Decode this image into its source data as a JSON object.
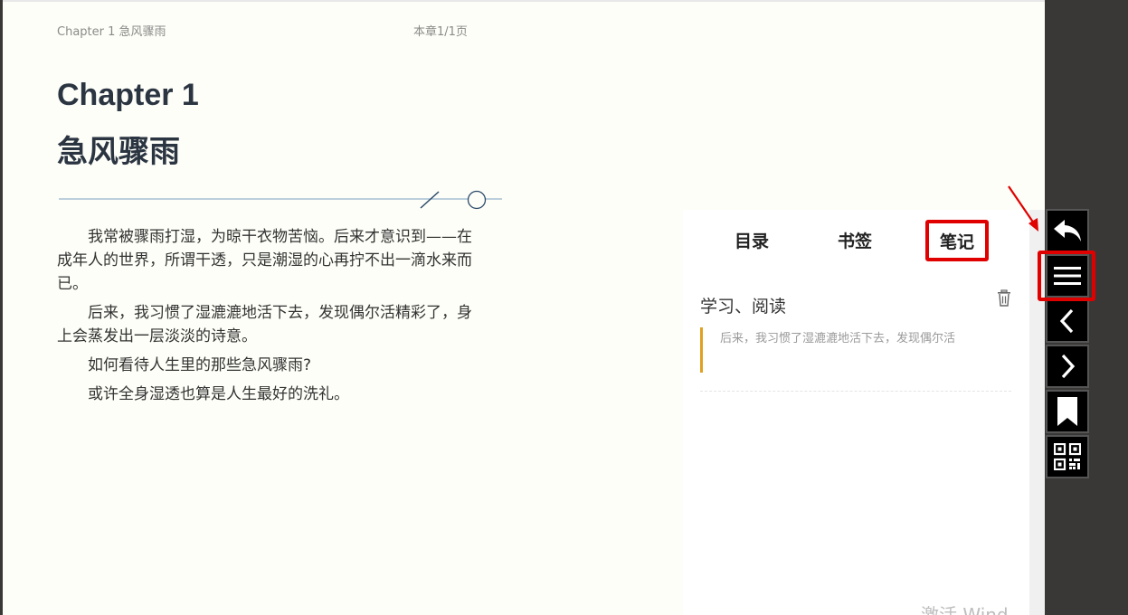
{
  "header": {
    "breadcrumb": "Chapter 1 急风骤雨",
    "page_indicator": "本章1/1页"
  },
  "chapter": {
    "title": "Chapter 1",
    "subtitle": "急风骤雨",
    "paragraphs": [
      "我常被骤雨打湿，为晾干衣物苦恼。后来才意识到——在成年人的世界，所谓干透，只是潮湿的心再拧不出一滴水来而已。",
      "后来，我习惯了湿漉漉地活下去，发现偶尔活精彩了，身上会蒸发出一层淡淡的诗意。",
      "如何看待人生里的那些急风骤雨?",
      "或许全身湿透也算是人生最好的洗礼。"
    ]
  },
  "panel": {
    "tabs": [
      {
        "label": "目录",
        "active": false
      },
      {
        "label": "书签",
        "active": false
      },
      {
        "label": "笔记",
        "active": true
      }
    ],
    "note": {
      "heading": "学习、阅读",
      "quote": "后来，我习惯了湿漉漉地活下去，发现偶尔活"
    },
    "watermark": "激活 Wind"
  },
  "toolbar": {
    "buttons": [
      {
        "icon": "back-arrow-icon"
      },
      {
        "icon": "menu-icon",
        "highlighted": true
      },
      {
        "icon": "chevron-left-icon"
      },
      {
        "icon": "chevron-right-icon"
      },
      {
        "icon": "bookmark-icon"
      },
      {
        "icon": "qr-code-icon"
      }
    ]
  },
  "colors": {
    "page_bg": "#fefef8",
    "frame_bg": "#3a3836",
    "highlight": "#e00000",
    "quote_bar": "#e0a020",
    "title": "#2b3542"
  }
}
